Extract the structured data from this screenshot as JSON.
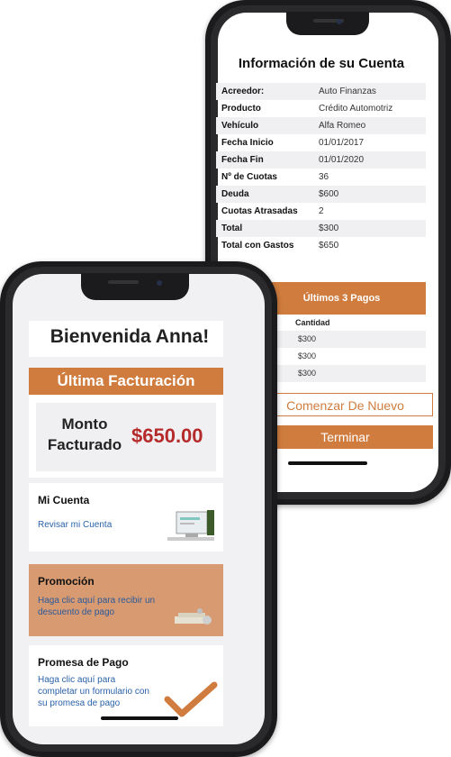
{
  "account": {
    "title": "Información de su Cuenta",
    "rows": [
      {
        "label": "Acreedor:",
        "value": "Auto Finanzas"
      },
      {
        "label": "Producto",
        "value": "Crédito Automotriz"
      },
      {
        "label": "Vehículo",
        "value": "Alfa Romeo"
      },
      {
        "label": "Fecha Inicio",
        "value": "01/01/2017"
      },
      {
        "label": "Fecha Fin",
        "value": "01/01/2020"
      },
      {
        "label": "Nº de Cuotas",
        "value": "36"
      },
      {
        "label": "Deuda",
        "value": "$600"
      },
      {
        "label": "Cuotas Atrasadas",
        "value": "2"
      },
      {
        "label": "Total",
        "value": "$300"
      },
      {
        "label": "Total con Gastos",
        "value": "$650"
      }
    ],
    "payments_title": "Últimos 3 Pagos",
    "payments_column": "Cantidad",
    "payments": [
      "$300",
      "$300",
      "$300"
    ],
    "restart_label": "Comenzar De Nuevo",
    "finish_label": "Terminar"
  },
  "home": {
    "welcome": "Bienvenida Anna!",
    "billing_title": "Última Facturación",
    "billed_label": "Monto Facturado",
    "billed_amount": "$650.00",
    "my_account_title": "Mi Cuenta",
    "my_account_link": "Revisar mi Cuenta",
    "promo_title": "Promoción",
    "promo_link": "Haga clic aquí para recibir un descuento de pago",
    "promise_title": "Promesa de Pago",
    "promise_link": "Haga clic aquí para completar un formulario con su promesa de pago"
  },
  "colors": {
    "accent": "#cf7c3e",
    "promo_bg": "#d89a70",
    "amount": "#b52a2a",
    "link": "#2a62a8"
  }
}
